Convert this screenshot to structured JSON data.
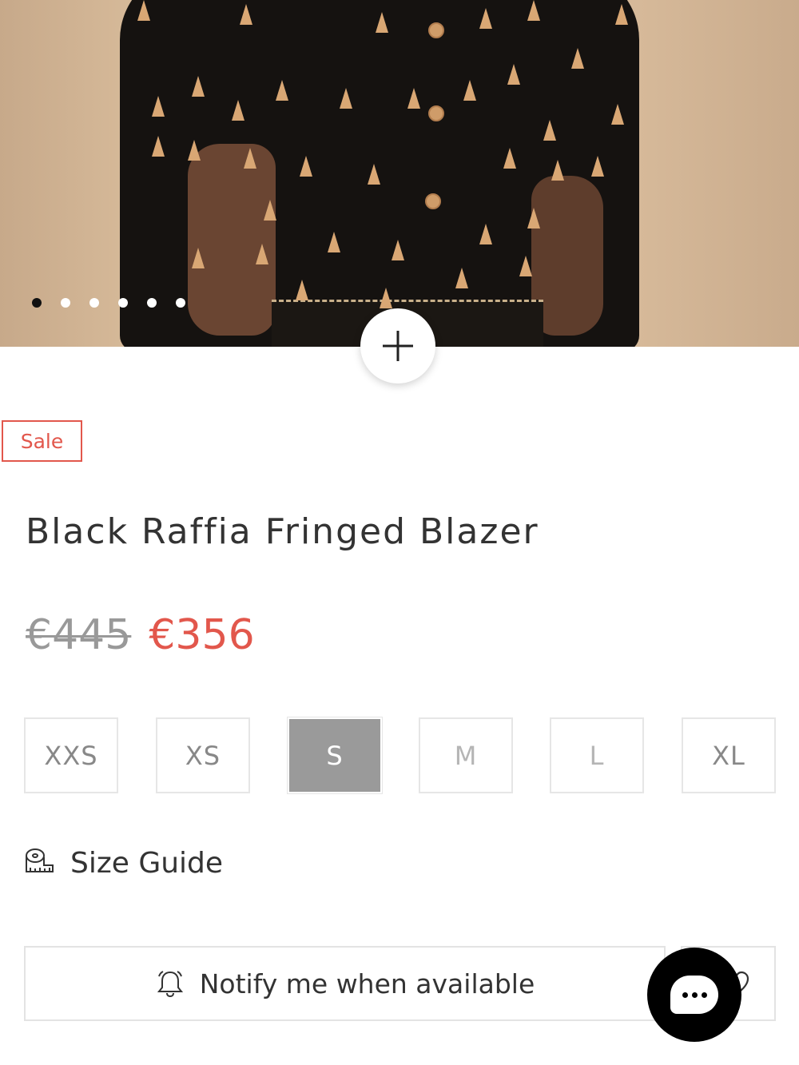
{
  "gallery": {
    "image_count": 6,
    "active_index": 0,
    "zoom_icon": "plus-icon"
  },
  "product": {
    "badge": "Sale",
    "title": "Black Raffia Fringed Blazer",
    "original_price": "€445",
    "sale_price": "€356"
  },
  "sizes": {
    "options": [
      {
        "label": "XXS",
        "state": "available"
      },
      {
        "label": "XS",
        "state": "available"
      },
      {
        "label": "S",
        "state": "selected"
      },
      {
        "label": "M",
        "state": "unavailable"
      },
      {
        "label": "L",
        "state": "unavailable"
      },
      {
        "label": "XL",
        "state": "available"
      }
    ]
  },
  "size_guide": {
    "label": "Size Guide",
    "icon": "measuring-tape-icon"
  },
  "actions": {
    "notify_label": "Notify me when available",
    "notify_icon": "bell-icon",
    "wishlist_icon": "heart-icon",
    "chat_icon": "chat-bubble-icon"
  },
  "colors": {
    "accent_red": "#e2574c",
    "selected_size_bg": "#9a9a9a",
    "border": "#e3e3e3"
  }
}
